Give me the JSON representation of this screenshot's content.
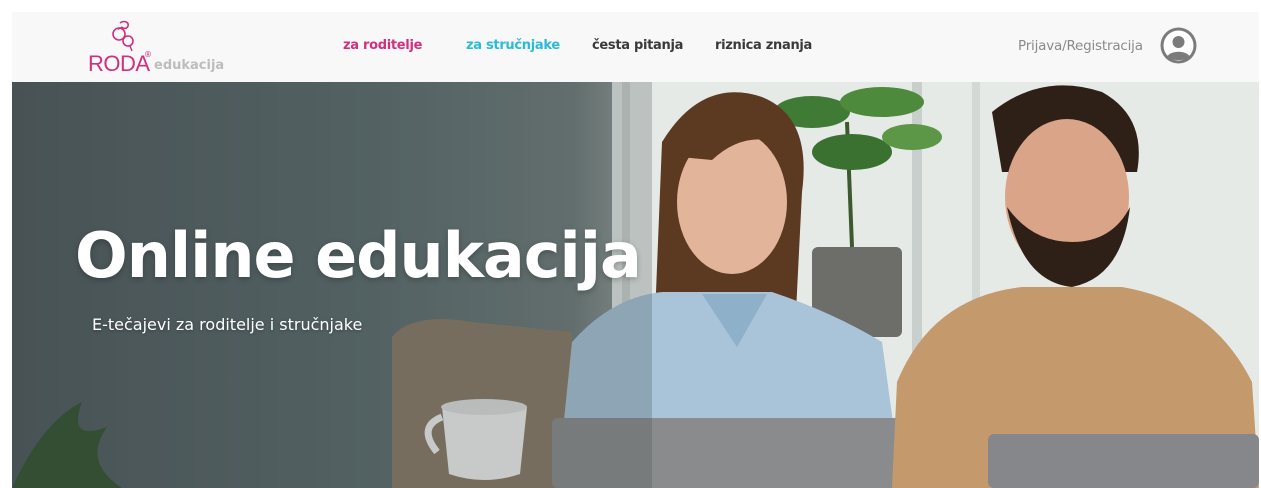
{
  "header": {
    "logo": {
      "brand": "RODA",
      "registered": "®",
      "product": "edukacija"
    },
    "nav": [
      {
        "label": "za roditelje"
      },
      {
        "label": "za stručnjake"
      },
      {
        "label": "česta pitanja"
      },
      {
        "label": "riznica znanja"
      }
    ],
    "login_label": "Prijava/Registracija",
    "avatar_icon": "user-circle-icon"
  },
  "hero": {
    "title": "Online edukacija",
    "subtitle": "E-tečajevi za roditelje i stručnjake"
  },
  "colors": {
    "brand_pink": "#d1307d",
    "accent_cyan": "#2bbbd9",
    "nav_dark": "#3a3a3a",
    "header_bg": "#f8f8f9"
  }
}
